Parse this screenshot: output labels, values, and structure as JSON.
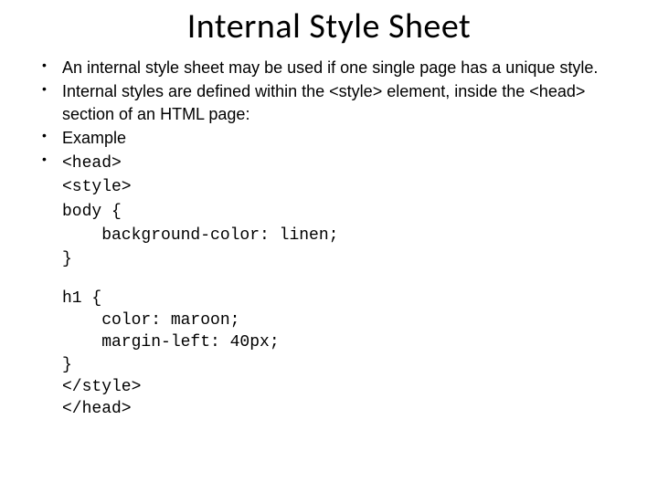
{
  "title": "Internal Style Sheet",
  "bullets": [
    "An internal style sheet may be used if one single page has a unique style.",
    "Internal styles are defined within the <style> element, inside the <head> section of an HTML page:",
    "Example",
    "<head>\n<style>\nbody {\n    background-color: linen;\n}"
  ],
  "code2": "h1 {\n    color: maroon;\n    margin-left: 40px;\n}\n</style>\n</head>"
}
